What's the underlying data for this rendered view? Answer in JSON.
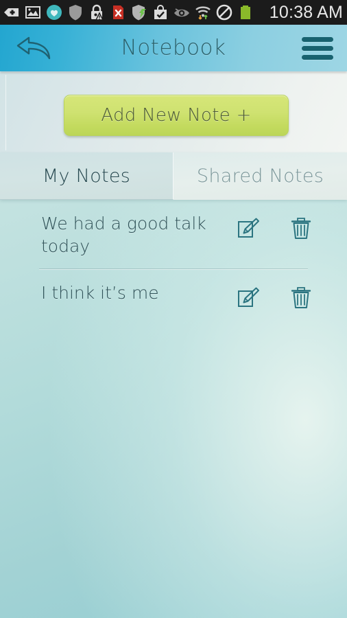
{
  "statusbar": {
    "time": "10:38 AM",
    "icons": [
      {
        "name": "add-tag-icon"
      },
      {
        "name": "gallery-image-icon"
      },
      {
        "name": "heart-shield-icon"
      },
      {
        "name": "shield-icon"
      },
      {
        "name": "lock-warning-icon"
      },
      {
        "name": "file-error-icon"
      },
      {
        "name": "shield-sync-icon"
      },
      {
        "name": "bag-check-icon"
      },
      {
        "name": "eye-icon"
      },
      {
        "name": "wifi-transfer-icon"
      },
      {
        "name": "blocked-icon"
      },
      {
        "name": "battery-icon"
      }
    ]
  },
  "header": {
    "title": "Notebook",
    "back_icon": "back-arrow-icon",
    "menu_icon": "hamburger-menu-icon"
  },
  "toolbar": {
    "add_note_label": "Add New Note +"
  },
  "tabs": [
    {
      "label": "My Notes",
      "active": true
    },
    {
      "label": "Shared Notes",
      "active": false
    }
  ],
  "notes": [
    {
      "text": "We had a good talk today",
      "edit_icon": "edit-note-icon",
      "delete_icon": "delete-note-icon"
    },
    {
      "text": "I think it’s me",
      "edit_icon": "edit-note-icon",
      "delete_icon": "delete-note-icon"
    }
  ],
  "colors": {
    "header_accent": "#37b1d6",
    "add_button": "#cfe271",
    "note_text": "#2e5157",
    "icon_stroke": "#2b7480",
    "status_bar": "#1b1b1b"
  }
}
